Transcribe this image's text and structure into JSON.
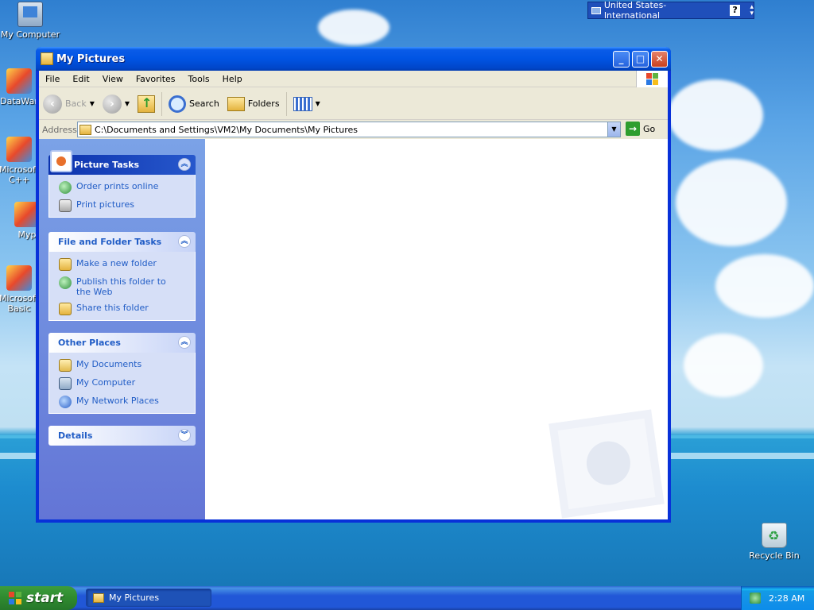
{
  "desktop": {
    "icons": [
      {
        "label": "My Computer"
      },
      {
        "label": "DataWar"
      },
      {
        "label": "Microsoft C++"
      },
      {
        "label": "Myp"
      },
      {
        "label": "Microsoft Basic"
      },
      {
        "label": "Recycle Bin"
      }
    ]
  },
  "langbar": {
    "label": "United States-International",
    "help": "?"
  },
  "window": {
    "title": "My Pictures",
    "menu": [
      "File",
      "Edit",
      "View",
      "Favorites",
      "Tools",
      "Help"
    ],
    "toolbar": {
      "back": "Back",
      "search": "Search",
      "folders": "Folders"
    },
    "address": {
      "label": "Address",
      "value": "C:\\Documents and Settings\\VM2\\My Documents\\My Pictures",
      "go": "Go"
    },
    "taskpane": {
      "picture_tasks": {
        "title": "Picture Tasks",
        "items": [
          "Order prints online",
          "Print pictures"
        ]
      },
      "file_folder_tasks": {
        "title": "File and Folder Tasks",
        "items": [
          "Make a new folder",
          "Publish this folder to the Web",
          "Share this folder"
        ]
      },
      "other_places": {
        "title": "Other Places",
        "items": [
          "My Documents",
          "My Computer",
          "My Network Places"
        ]
      },
      "details": {
        "title": "Details"
      }
    }
  },
  "taskbar": {
    "start": "start",
    "task": "My Pictures",
    "clock": "2:28 AM"
  }
}
